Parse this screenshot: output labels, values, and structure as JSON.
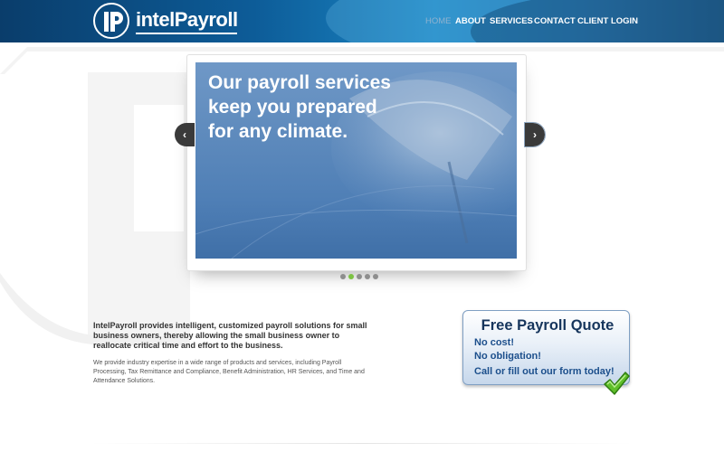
{
  "brand": {
    "name": "intelPayroll",
    "logo_letters": "iP"
  },
  "nav": {
    "items": [
      {
        "label": "HOME",
        "active": true
      },
      {
        "label": "ABOUT",
        "active": false
      },
      {
        "label": "SERVICES",
        "active": false
      },
      {
        "label": "CONTACT",
        "active": false
      },
      {
        "label": "CLIENT LOGIN",
        "active": false
      }
    ]
  },
  "slider": {
    "headline": [
      "Our payroll services",
      "keep you prepared",
      "for any climate."
    ],
    "prev_icon": "chevron-left-icon",
    "next_icon": "chevron-right-icon",
    "prev_glyph": "‹",
    "next_glyph": "›",
    "slide_count": 5,
    "active_index": 1
  },
  "content": {
    "intro": "IntelPayroll provides intelligent, customized payroll solutions for small business owners, thereby allowing the small business owner to reallocate critical time and effort to the business.",
    "description": "We provide industry expertise in a wide range of products and services, including Payroll Processing, Tax Remittance and Compliance, Benefit Administration, HR Services, and Time and Attendance Solutions."
  },
  "quote_box": {
    "title": "Free Payroll Quote",
    "lines": [
      "No cost!",
      "No obligation!",
      "Call or fill out our form today!"
    ],
    "icon": "checkmark-icon"
  },
  "colors": {
    "header_dark": "#0a3d6b",
    "header_light": "#1b86c4",
    "dot_active": "#7cc243",
    "dot_inactive": "#8e8e8e",
    "quote_title": "#16355c",
    "quote_text": "#1c4f8c"
  }
}
